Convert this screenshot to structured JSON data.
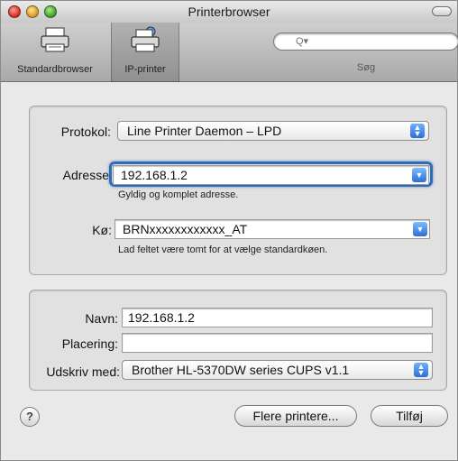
{
  "window": {
    "title": "Printerbrowser"
  },
  "toolbar": {
    "tabs": [
      {
        "label": "Standardbrowser",
        "icon": "printer-icon"
      },
      {
        "label": "IP-printer",
        "icon": "ip-printer-icon",
        "selected": true
      }
    ],
    "search": {
      "placeholder": "Q▾",
      "label": "Søg"
    }
  },
  "connection": {
    "protocol_label": "Protokol:",
    "protocol_value": "Line Printer Daemon – LPD",
    "address_label": "Adresse",
    "address_value": "192.168.1.2",
    "address_hint": "Gyldig og komplet adresse.",
    "queue_label": "Kø:",
    "queue_value": "BRNxxxxxxxxxxxx_AT",
    "queue_hint": "Lad feltet være tomt for at vælge standardkøen."
  },
  "details": {
    "name_label": "Navn:",
    "name_value": "192.168.1.2",
    "location_label": "Placering:",
    "location_value": "",
    "print_with_label": "Udskriv med:",
    "print_with_value": "Brother HL-5370DW series CUPS v1.1"
  },
  "buttons": {
    "help_label": "?",
    "more_printers_label": "Flere printere...",
    "add_label": "Tilføj"
  },
  "colors": {
    "focus_ring": "#2e6bb8",
    "popup_arrow": "#2a6fd6"
  }
}
